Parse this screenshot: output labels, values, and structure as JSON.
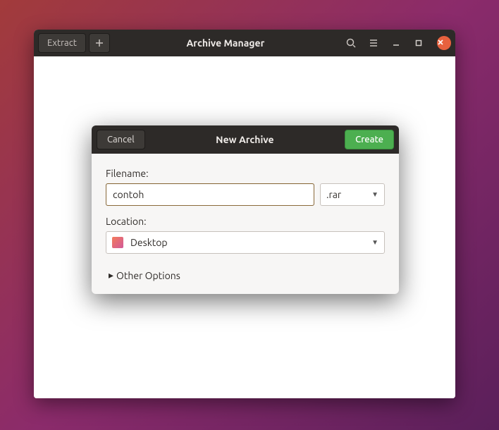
{
  "mainWindow": {
    "extractLabel": "Extract",
    "title": "Archive Manager"
  },
  "dialog": {
    "cancelLabel": "Cancel",
    "title": "New Archive",
    "createLabel": "Create",
    "filenameLabel": "Filename:",
    "filenameValue": "contoh",
    "extensionValue": ".rar",
    "locationLabel": "Location:",
    "locationValue": "Desktop",
    "otherOptionsLabel": "Other Options"
  }
}
